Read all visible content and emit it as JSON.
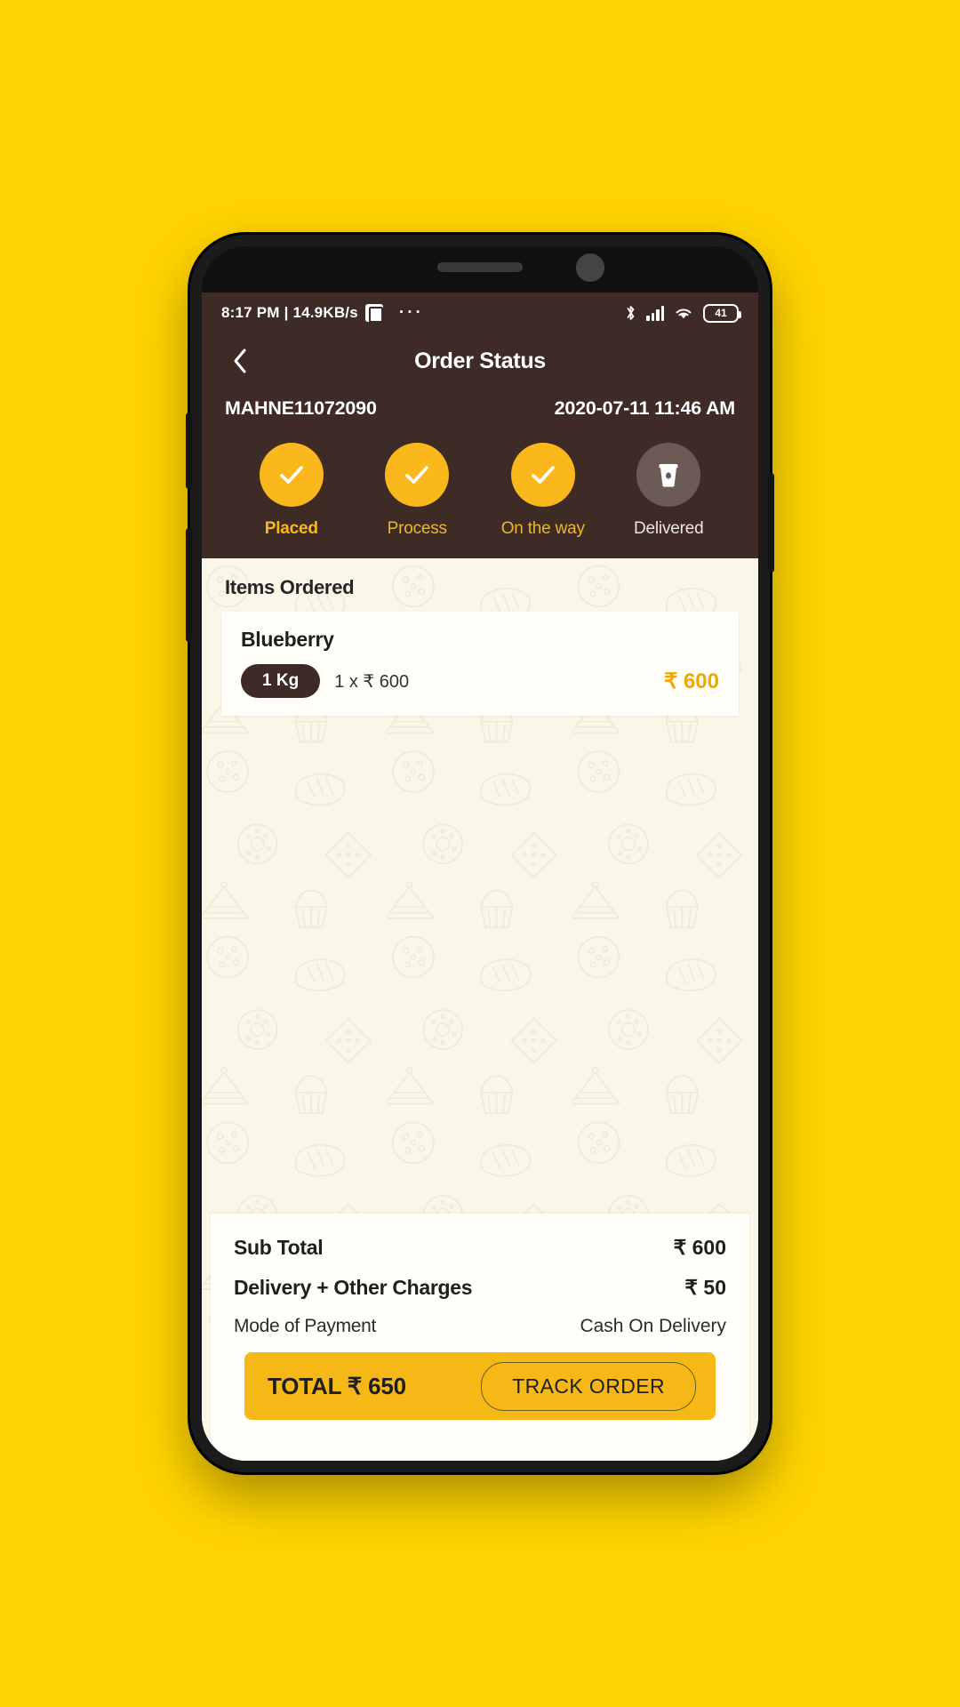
{
  "statusbar": {
    "time_and_speed": "8:17 PM | 14.9KB/s",
    "app_icon": "app-notification-icon",
    "overflow": "···",
    "bluetooth_icon": "bluetooth-icon",
    "signal_icon": "cellular-signal-icon",
    "wifi_icon": "wifi-icon",
    "battery_level": "41"
  },
  "navbar": {
    "back_icon": "chevron-left-icon",
    "title": "Order Status"
  },
  "order": {
    "id": "MAHNE11072090",
    "datetime": "2020-07-11 11:46 AM"
  },
  "steps": [
    {
      "label": "Placed",
      "state": "done",
      "icon": "check-icon"
    },
    {
      "label": "Process",
      "state": "done",
      "icon": "check-icon"
    },
    {
      "label": "On the way",
      "state": "done",
      "icon": "check-icon"
    },
    {
      "label": "Delivered",
      "state": "pending",
      "icon": "coffee-cup-icon"
    }
  ],
  "items_section": {
    "title": "Items Ordered",
    "items": [
      {
        "name": "Blueberry",
        "quantity_label": "1 Kg",
        "line": "1 x ₹ 600",
        "price": "₹ 600"
      }
    ]
  },
  "totals": {
    "rows": [
      {
        "label": "Sub Total",
        "value": "₹ 600"
      },
      {
        "label": "Delivery + Other Charges",
        "value": "₹ 50"
      },
      {
        "label": "Mode of Payment",
        "value": "Cash On Delivery"
      }
    ],
    "total_text": "TOTAL ₹ 650",
    "track_button": "TRACK ORDER"
  },
  "colors": {
    "brand_yellow": "#FFD400",
    "accent_yellow": "#FBB81C",
    "header_brown": "#3E2B26",
    "cream": "#FAF7E9",
    "pending_grey": "#6B5A55"
  }
}
